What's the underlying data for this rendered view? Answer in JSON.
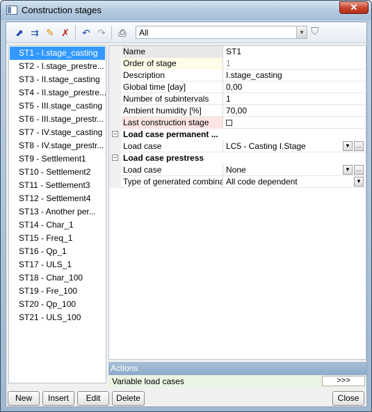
{
  "window": {
    "title": "Construction stages",
    "close_glyph": "✕"
  },
  "toolbar": {
    "filter_value": "All",
    "icons": [
      "select-icon",
      "match-icon",
      "edit-icon",
      "delete-icon",
      "undo-icon",
      "redo-icon",
      "print-icon",
      "filter-icon"
    ]
  },
  "stages": [
    "ST1 - I.stage_casting",
    "ST2 - I.stage_prestre...",
    "ST3 - II.stage_casting",
    "ST4 - II.stage_prestre...",
    "ST5 - III.stage_casting",
    "ST6 - III.stage_prestr...",
    "ST7 - IV.stage_casting",
    "ST8 - IV.stage_prestr...",
    "ST9 - Settlement1",
    "ST10 - Settlement2",
    "ST11 - Settlement3",
    "ST12 - Settlement4",
    "ST13 - Another per...",
    "ST14 - Char_1",
    "ST15 - Freq_1",
    "ST16 - Qp_1",
    "ST17 - ULS_1",
    "ST18 - Char_100",
    "ST19 - Fre_100",
    "ST20 - Qp_100",
    "ST21 - ULS_100"
  ],
  "properties": {
    "name_label": "Name",
    "name_value": "ST1",
    "order_label": "Order of stage",
    "order_value": "1",
    "desc_label": "Description",
    "desc_value": "I.stage_casting",
    "time_label": "Global time [day]",
    "time_value": "0,00",
    "subint_label": "Number of subintervals",
    "subint_value": "1",
    "humid_label": "Ambient humidity [%]",
    "humid_value": "70,00",
    "last_label": "Last construction stage",
    "perm_header": "Load case permanent ...",
    "perm_lc_label": "Load case",
    "perm_lc_value": "LC5 - Casting I.Stage",
    "prest_header": "Load case prestress",
    "prest_lc_label": "Load case",
    "prest_lc_value": "None",
    "type_label": "Type of generated combina...",
    "type_value": "All code dependent",
    "expander_glyph": "−",
    "ellipsis": "..."
  },
  "actions": {
    "header": "Actions",
    "row_label": "Variable load cases",
    "more_label": ">>>"
  },
  "buttons": {
    "new": "New",
    "insert": "Insert",
    "edit": "Edit",
    "delete": "Delete",
    "close": "Close"
  }
}
